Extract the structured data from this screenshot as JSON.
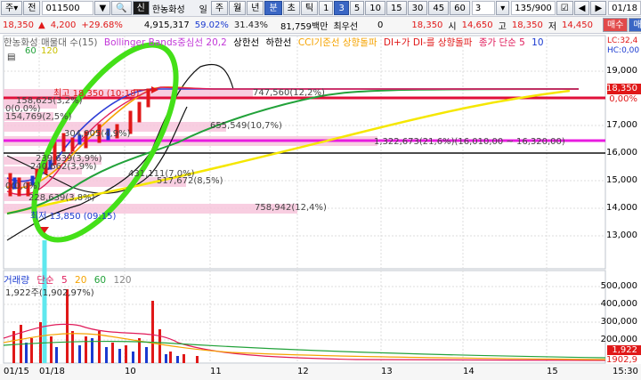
{
  "toolbar": {
    "market": "주",
    "arrow": "▾",
    "prev": "전",
    "code": "011500",
    "search_icon": "search-icon",
    "sin_badge": "신",
    "name": "한농화성",
    "periods": [
      "일",
      "주",
      "월",
      "년",
      "분",
      "초",
      "틱",
      "1",
      "3",
      "5",
      "10",
      "15",
      "30",
      "45",
      "60"
    ],
    "active_periods": [
      "분",
      "3"
    ],
    "count": "3",
    "page": "135/900",
    "date": "01/18",
    "right_buttons": [
      "매수",
      "매도"
    ]
  },
  "quote": {
    "price": "18,350",
    "change": "4,200",
    "change_pct": "+29.68%",
    "volume": "4,915,317",
    "vol_ratio": "59.02%",
    "turnover": "31.43%",
    "amount": "81,759백만",
    "limit_label": "최우선",
    "zero": "0",
    "cur": "18,350",
    "open_label": "시",
    "open": "14,650",
    "high_label": "고",
    "high": "18,350",
    "low_label": "저",
    "low": "14,450"
  },
  "legend": {
    "name": "한농화성 매물대 수(15)",
    "bollinger": "Bollinger Bands중심선 20,2",
    "upper": "상한선",
    "lower": "하한선",
    "cci": "CCI기준선 상향돌파",
    "dmi": "DI+가 DI-를 상향돌파",
    "ma": "종가 단순 5",
    "ma_values": [
      "10",
      "60",
      "120"
    ],
    "right_top": "LC:32,4",
    "right_hc": "HC:0,00"
  },
  "annotations": {
    "high": "최고 18,350 (10:18)",
    "low": "최저 13,850 (09:15)",
    "profiles": [
      "747,560(12,2%)",
      "655,549(10,7%)",
      "1,322,673(21,6%)(16,010,00 ~ 16,320,00)",
      "517,672(8,5%)",
      "758,942(12,4%)",
      "158,625(3,2%)",
      "154,769(2,5%)",
      "0(0,0%)",
      "304,905(4,9%)",
      "431,111(7,0%)",
      "239,639(3,9%)",
      "240,662(3,9%)",
      "228,639(3,8%)",
      "0(0,0%)"
    ]
  },
  "price_axis": [
    "19,000",
    "18,000",
    "17,000",
    "16,000",
    "15,000",
    "14,000",
    "13,000"
  ],
  "price_box": "18,350",
  "pct_box": "0,00%",
  "volume_legend": {
    "label": "거래량",
    "ma": "단순",
    "values": [
      "5",
      "20",
      "60",
      "120"
    ],
    "summary": "1,922주(1,902,97%)"
  },
  "volume_axis": [
    "500,000",
    "400,000",
    "300,000",
    "200,000",
    "100,000"
  ],
  "volume_box": "1,922",
  "volume_box2": "1902,9",
  "x_axis": [
    "01/15",
    "01/18",
    "10",
    "11",
    "12",
    "13",
    "14",
    "15"
  ],
  "clock": "15:30"
}
